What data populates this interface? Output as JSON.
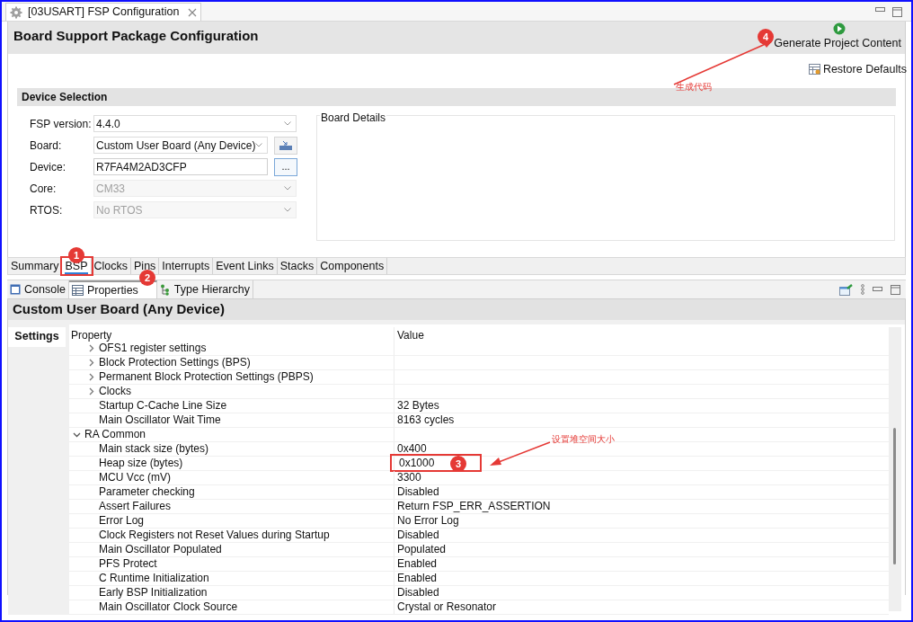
{
  "editor_tab": {
    "title": "[03USART] FSP Configuration"
  },
  "header": {
    "title": "Board Support Package Configuration",
    "generate_button": "Generate Project Content",
    "restore_button": "Restore Defaults"
  },
  "device_selection": {
    "title": "Device Selection",
    "fields": [
      {
        "label": "FSP version:",
        "value": "4.4.0",
        "kind": "combo",
        "disabled": false
      },
      {
        "label": "Board:",
        "value": "Custom User Board (Any Device)",
        "kind": "combo",
        "disabled": false,
        "icon_button": true
      },
      {
        "label": "Device:",
        "value": "R7FA4M2AD3CFP",
        "kind": "text",
        "disabled": false,
        "button_label": "..."
      },
      {
        "label": "Core:",
        "value": "CM33",
        "kind": "combo",
        "disabled": true
      },
      {
        "label": "RTOS:",
        "value": "No RTOS",
        "kind": "combo",
        "disabled": true
      }
    ],
    "board_details": {
      "title": "Board Details"
    }
  },
  "editor_tabs": [
    {
      "label": "Summary",
      "selected": false,
      "highlighted": false
    },
    {
      "label": "BSP",
      "selected": true,
      "highlighted": true
    },
    {
      "label": "Clocks",
      "selected": false,
      "highlighted": false
    },
    {
      "label": "Pins",
      "selected": false,
      "highlighted": false
    },
    {
      "label": "Interrupts",
      "selected": false,
      "highlighted": false
    },
    {
      "label": "Event Links",
      "selected": false,
      "highlighted": false
    },
    {
      "label": "Stacks",
      "selected": false,
      "highlighted": false
    },
    {
      "label": "Components",
      "selected": false,
      "highlighted": false
    }
  ],
  "view_tabs": [
    {
      "label": "Console",
      "selected": false,
      "kind": "console"
    },
    {
      "label": "Properties",
      "selected": true,
      "kind": "properties"
    },
    {
      "label": "Type Hierarchy",
      "selected": false,
      "kind": "hierarchy"
    }
  ],
  "properties": {
    "title": "Custom User Board (Any Device)",
    "side_tab": "Settings",
    "columns": [
      "Property",
      "Value"
    ],
    "tree": [
      {
        "children": [
          {
            "label": "OFS1 register settings",
            "expanded": false
          },
          {
            "label": "Block Protection Settings (BPS)",
            "expanded": false
          },
          {
            "label": "Permanent Block Protection Settings (PBPS)",
            "expanded": false
          },
          {
            "label": "Clocks",
            "expanded": false
          },
          {
            "label": "Startup C-Cache Line Size",
            "value": "32 Bytes"
          },
          {
            "label": "Main Oscillator Wait Time",
            "value": "8163 cycles"
          }
        ]
      },
      {
        "label": "RA Common",
        "expanded": true,
        "children": [
          {
            "label": "Main stack size (bytes)",
            "value": "0x400"
          },
          {
            "label": "Heap size (bytes)",
            "value": "0x1000",
            "highlighted": true
          },
          {
            "label": "MCU Vcc (mV)",
            "value": "3300"
          },
          {
            "label": "Parameter checking",
            "value": "Disabled"
          },
          {
            "label": "Assert Failures",
            "value": "Return FSP_ERR_ASSERTION"
          },
          {
            "label": "Error Log",
            "value": "No Error Log"
          },
          {
            "label": "Clock Registers not Reset Values during Startup",
            "value": "Disabled"
          },
          {
            "label": "Main Oscillator Populated",
            "value": "Populated"
          },
          {
            "label": "PFS Protect",
            "value": "Enabled"
          },
          {
            "label": "C Runtime Initialization",
            "value": "Enabled"
          },
          {
            "label": "Early BSP Initialization",
            "value": "Disabled"
          },
          {
            "label": "Main Oscillator Clock Source",
            "value": "Crystal or Resonator"
          }
        ]
      }
    ]
  },
  "annotations": {
    "markers": [
      "1",
      "2",
      "3",
      "4"
    ],
    "notes": [
      "生成代码",
      "设置堆空间大小"
    ]
  }
}
